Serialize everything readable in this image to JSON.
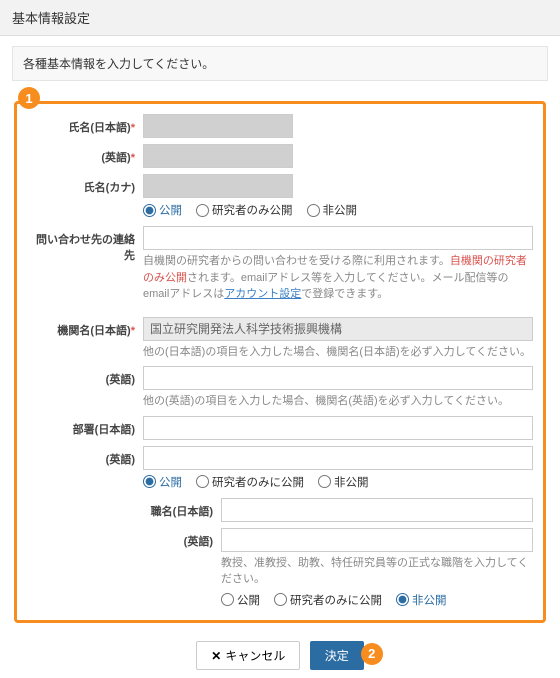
{
  "header": {
    "title": "基本情報設定"
  },
  "instruction": "各種基本情報を入力してください。",
  "badges": {
    "b1": "1",
    "b2": "2"
  },
  "name": {
    "label_jp": "氏名(日本語)",
    "label_en": "(英語)",
    "label_kana": "氏名(カナ)"
  },
  "visibility1": {
    "opt1": "公開",
    "opt2": "研究者のみ公開",
    "opt3": "非公開"
  },
  "contact": {
    "label": "問い合わせ先の連絡先",
    "hint_pre": "自機関の研究者からの問い合わせを受ける際に利用されます。",
    "hint_warn": "自機関の研究者のみ公開",
    "hint_post1": "されます。emailアドレス等を入力してください。メール配信等のemailアドレスは",
    "hint_link": "アカウント設定",
    "hint_post2": "で登録できます。"
  },
  "org": {
    "label_jp": "機関名(日本語)",
    "value_jp": "国立研究開発法人科学技術振興機構",
    "hint_jp": "他の(日本語)の項目を入力した場合、機関名(日本語)を必ず入力してください。",
    "label_en": "(英語)",
    "hint_en": "他の(英語)の項目を入力した場合、機関名(英語)を必ず入力してください。"
  },
  "dept": {
    "label_jp": "部署(日本語)",
    "label_en": "(英語)"
  },
  "visibility2": {
    "opt1": "公開",
    "opt2": "研究者のみに公開",
    "opt3": "非公開"
  },
  "position": {
    "label_jp": "職名(日本語)",
    "label_en": "(英語)",
    "hint": "教授、准教授、助教、特任研究員等の正式な職階を入力してください。"
  },
  "visibility3": {
    "opt1": "公開",
    "opt2": "研究者のみに公開",
    "opt3": "非公開"
  },
  "buttons": {
    "cancel": "キャンセル",
    "submit": "決定"
  }
}
